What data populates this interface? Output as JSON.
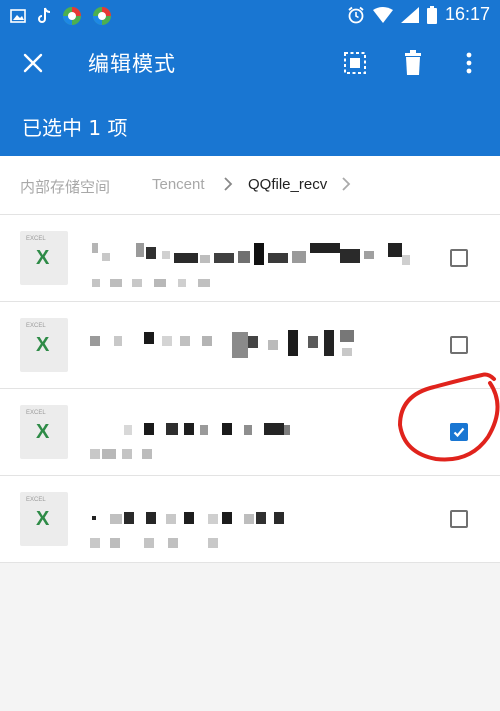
{
  "status_bar": {
    "time": "16:17"
  },
  "toolbar": {
    "title": "编辑模式",
    "close_icon": "close-icon",
    "select_all_icon": "select-all-icon",
    "delete_icon": "trash-icon",
    "more_icon": "more-vert-icon"
  },
  "selection": {
    "label": "已选中 1 项"
  },
  "breadcrumb": {
    "items": [
      "内部存储空间",
      "Tencent",
      "QQfile_recv"
    ]
  },
  "files": [
    {
      "type_label": "EXCEL",
      "icon_letter": "X",
      "checked": false
    },
    {
      "type_label": "EXCEL",
      "icon_letter": "X",
      "checked": false
    },
    {
      "type_label": "EXCEL",
      "icon_letter": "X",
      "checked": true
    },
    {
      "type_label": "EXCEL",
      "icon_letter": "X",
      "checked": false
    }
  ],
  "colors": {
    "primary": "#1976d2",
    "excel_green": "#2e8b47",
    "annotation_red": "#e0231c"
  }
}
